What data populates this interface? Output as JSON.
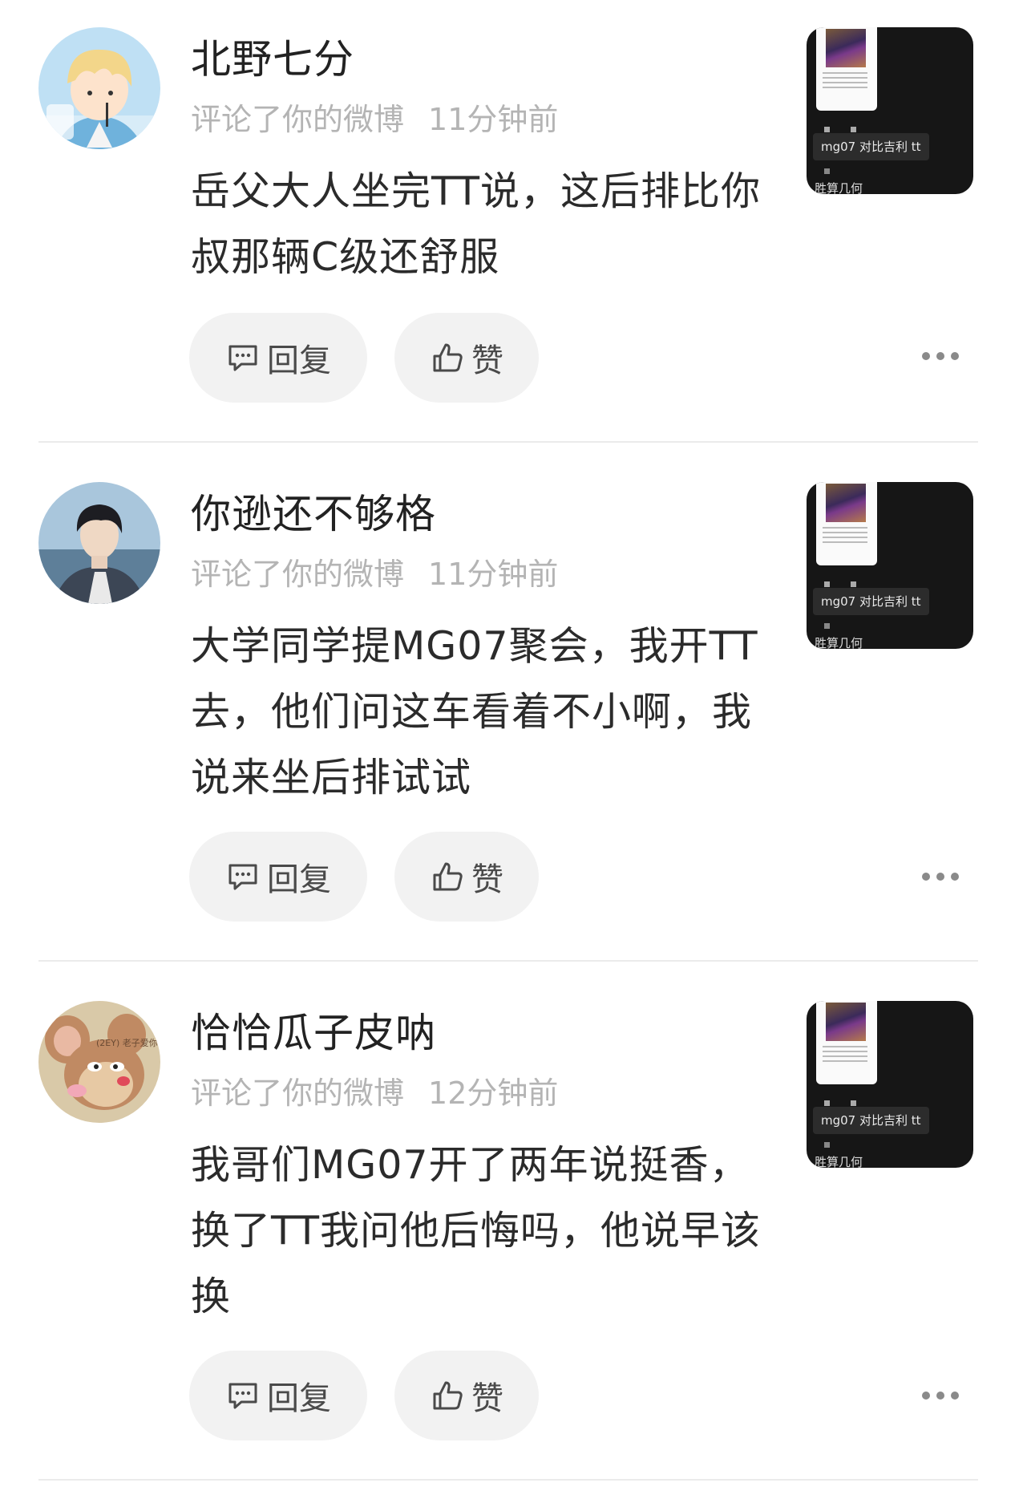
{
  "comments": [
    {
      "username": "北野七分",
      "action": "评论了你的微博",
      "time": "11分钟前",
      "text": "岳父大人坐完TT说，这后排比你叔那辆C级还舒服",
      "avatar_icon": "avatar-blond-boy-icon",
      "thumbnail": {
        "tag": "mg07 对比吉利 tt",
        "caption": "胜算几何"
      }
    },
    {
      "username": "你逊还不够格",
      "action": "评论了你的微博",
      "time": "11分钟前",
      "text": "大学同学提MG07聚会，我开TT去，他们问这车看着不小啊，我说来坐后排试试",
      "avatar_icon": "avatar-young-man-icon",
      "thumbnail": {
        "tag": "mg07 对比吉利 tt",
        "caption": "胜算几何"
      }
    },
    {
      "username": "恰恰瓜子皮呐",
      "action": "评论了你的微博",
      "time": "12分钟前",
      "text": "我哥们MG07开了两年说挺香，换了TT我问他后悔吗，他说早该换",
      "avatar_icon": "avatar-cartoon-mouse-icon",
      "avatar_caption": "(2EY) 老子爱你",
      "thumbnail": {
        "tag": "mg07 对比吉利 tt",
        "caption": "胜算几何"
      }
    }
  ],
  "actions": {
    "reply_label": "回复",
    "like_label": "赞"
  },
  "colors": {
    "meta": "#b4b4b4",
    "pill_bg": "#f2f2f2",
    "thumb_bg": "#161616"
  }
}
